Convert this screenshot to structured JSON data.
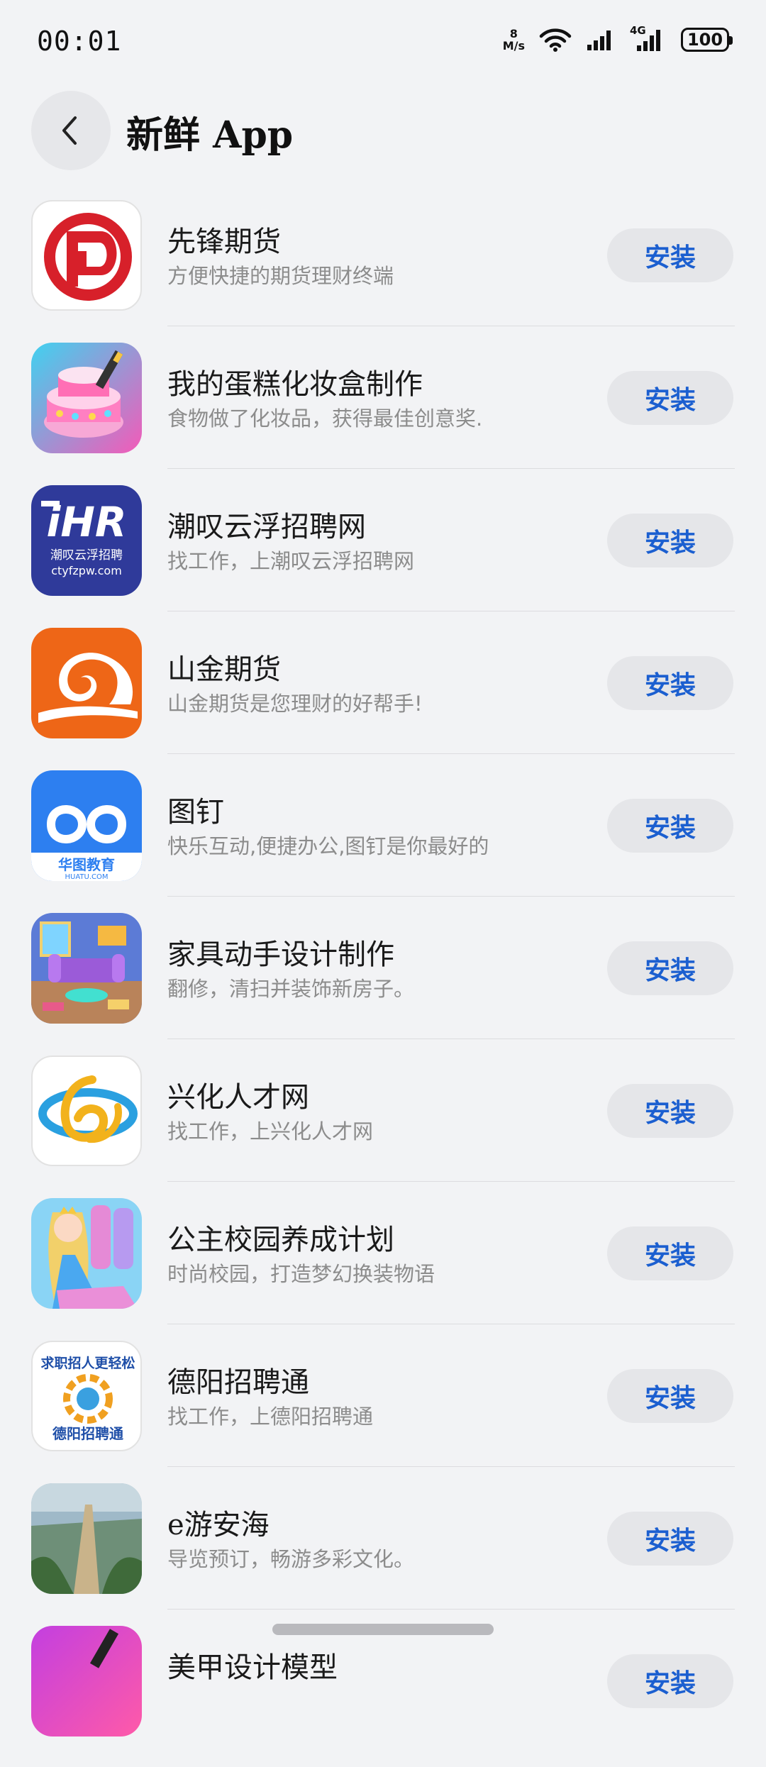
{
  "status_bar": {
    "time": "00:01",
    "net_speed_value": "8",
    "net_speed_unit": "M/s",
    "network_type": "4G",
    "battery": "100",
    "icons": [
      "wifi-icon",
      "signal-icon",
      "signal-4g-icon",
      "battery-icon"
    ]
  },
  "header": {
    "title": "新鲜 App",
    "back_icon": "chevron-left-icon"
  },
  "colors": {
    "background": "#f2f3f5",
    "install_text": "#1b5fd0",
    "install_bg": "#e5e6e9"
  },
  "apps": [
    {
      "name": "先锋期货",
      "desc": "方便快捷的期货理财终端",
      "action": "安装"
    },
    {
      "name": "我的蛋糕化妆盒制作",
      "desc": "食物做了化妆品，获得最佳创意奖.",
      "action": "安装"
    },
    {
      "name": "潮叹云浮招聘网",
      "desc": "找工作，上潮叹云浮招聘网",
      "action": "安装",
      "icon_text": "潮叹云浮招聘",
      "icon_sub": "ctyfzpw.com"
    },
    {
      "name": "山金期货",
      "desc": "山金期货是您理财的好帮手!",
      "action": "安装"
    },
    {
      "name": "图钉",
      "desc": "快乐互动,便捷办公,图钉是你最好的",
      "action": "安装",
      "icon_text": "华图教育",
      "icon_sub": "HUATU.COM"
    },
    {
      "name": "家具动手设计制作",
      "desc": "翻修，清扫并装饰新房子。",
      "action": "安装"
    },
    {
      "name": "兴化人才网",
      "desc": "找工作，上兴化人才网",
      "action": "安装"
    },
    {
      "name": "公主校园养成计划",
      "desc": "时尚校园，打造梦幻换装物语",
      "action": "安装"
    },
    {
      "name": "德阳招聘通",
      "desc": "找工作，上德阳招聘通",
      "action": "安装",
      "icon_text": "德阳招聘通",
      "icon_sub": "求职招人更轻松"
    },
    {
      "name": "e游安海",
      "desc": "导览预订，畅游多彩文化。",
      "action": "安装"
    },
    {
      "name": "美甲设计模型",
      "desc": "",
      "action": "安装"
    }
  ]
}
